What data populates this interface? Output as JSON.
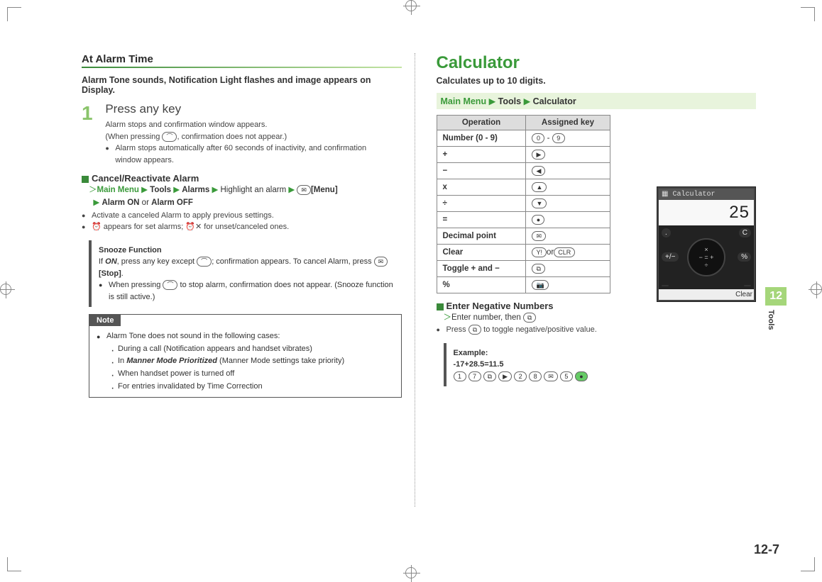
{
  "left": {
    "section_title": "At Alarm Time",
    "intro": "Alarm Tone sounds, Notification Light flashes and image appears on Display.",
    "step1_num": "1",
    "step1_title": "Press any key",
    "step1_line1": "Alarm stops and confirmation window appears.",
    "step1_line2a": "(When pressing ",
    "step1_line2b": ", confirmation does not appear.)",
    "step1_bullet": "Alarm stops automatically after 60 seconds of inactivity, and confirmation window appears.",
    "cancel_title": "Cancel/Reactivate Alarm",
    "nav": {
      "main": "Main Menu",
      "tools": "Tools",
      "alarms": "Alarms",
      "highlight": "Highlight an alarm",
      "menu": "[Menu]",
      "on": "Alarm ON",
      "or": " or ",
      "off": "Alarm OFF"
    },
    "cancel_b1": "Activate a canceled Alarm to apply previous settings.",
    "cancel_b2a": " appears for set alarms; ",
    "cancel_b2b": " for unset/canceled ones.",
    "snooze_title": "Snooze Function",
    "snooze_line1a": "If ",
    "snooze_on": "ON",
    "snooze_line1b": ", press any key except ",
    "snooze_line1c": "; confirmation appears. To cancel Alarm, press ",
    "snooze_stop": "[Stop]",
    "snooze_line1d": ".",
    "snooze_bullet_a": "When pressing ",
    "snooze_bullet_b": " to stop alarm, confirmation does not appear. (Snooze function is still active.)",
    "note_label": "Note",
    "note_b1": "Alarm Tone does not sound in the following cases:",
    "note_s1": "During a call (Notification appears and handset vibrates)",
    "note_s2a": "In ",
    "note_s2_em": "Manner Mode Prioritized",
    "note_s2b": " (Manner Mode settings take priority)",
    "note_s3": "When handset power is turned off",
    "note_s4": "For entries invalidated by Time Correction"
  },
  "right": {
    "title": "Calculator",
    "subtitle": "Calculates up to 10 digits.",
    "path": {
      "main": "Main Menu",
      "tools": "Tools",
      "calc": "Calculator"
    },
    "table": {
      "h1": "Operation",
      "h2": "Assigned key",
      "rows": [
        {
          "op": "Number (0 - 9)",
          "k1": "0",
          "sep": " - ",
          "k2": "9"
        },
        {
          "op": "+",
          "icon": "right"
        },
        {
          "op": "−",
          "icon": "left"
        },
        {
          "op": "x",
          "icon": "up"
        },
        {
          "op": "÷",
          "icon": "down"
        },
        {
          "op": "=",
          "icon": "center"
        },
        {
          "op": "Decimal point",
          "icon": "mail"
        },
        {
          "op": "Clear",
          "icon": "y",
          "or": "or",
          "icon2": "clr"
        },
        {
          "op": "Toggle + and −",
          "icon": "app"
        },
        {
          "op": "%",
          "icon": "cam"
        }
      ]
    },
    "neg_title": "Enter Negative Numbers",
    "neg_line": "Enter number, then ",
    "neg_bullet_a": "Press ",
    "neg_bullet_b": " to toggle negative/positive value.",
    "example_title": "Example:",
    "example_eq": "-17+28.5=11.5",
    "example_keys": [
      "1",
      "7",
      "⧉",
      "▶",
      "2",
      "8",
      "✉",
      "5",
      "●"
    ]
  },
  "phone": {
    "title": "Calculator",
    "display": "25",
    "clear": "Clear"
  },
  "side": {
    "chapter": "12",
    "label": "Tools"
  },
  "pagenum": "12-7",
  "glyph": {
    "end": "⌒",
    "mail": "✉",
    "clock_set": "⏰",
    "clock_off": "⏰✕",
    "right": "▶",
    "left": "◀",
    "up": "▲",
    "down": "▼",
    "center": "●",
    "y": "Y!",
    "clr": "CLR",
    "app": "⧉",
    "cam": "📷"
  }
}
